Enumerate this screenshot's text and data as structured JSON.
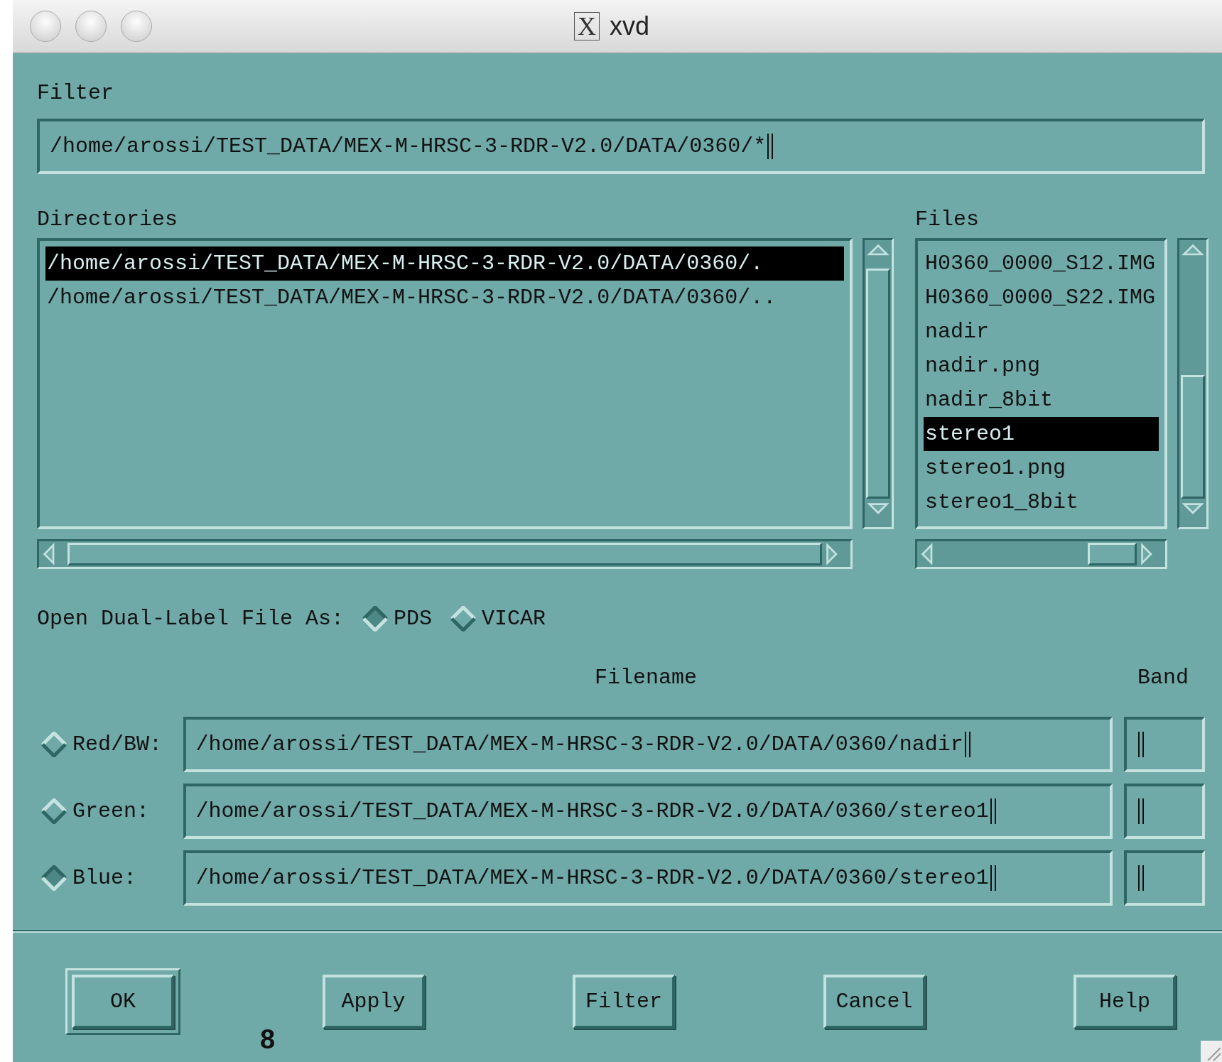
{
  "window": {
    "title": "xvd",
    "title_badge": "X"
  },
  "filter": {
    "label": "Filter",
    "value": "/home/arossi/TEST_DATA/MEX-M-HRSC-3-RDR-V2.0/DATA/0360/*"
  },
  "directories": {
    "label": "Directories",
    "items": [
      {
        "text": "/home/arossi/TEST_DATA/MEX-M-HRSC-3-RDR-V2.0/DATA/0360/.",
        "selected": true
      },
      {
        "text": "/home/arossi/TEST_DATA/MEX-M-HRSC-3-RDR-V2.0/DATA/0360/..",
        "selected": false
      }
    ]
  },
  "files": {
    "label": "Files",
    "items": [
      {
        "text": "H0360_0000_S12.IMG",
        "selected": false
      },
      {
        "text": "H0360_0000_S22.IMG",
        "selected": false
      },
      {
        "text": "nadir",
        "selected": false
      },
      {
        "text": "nadir.png",
        "selected": false
      },
      {
        "text": "nadir_8bit",
        "selected": false
      },
      {
        "text": "stereo1",
        "selected": true
      },
      {
        "text": "stereo1.png",
        "selected": false
      },
      {
        "text": "stereo1_8bit",
        "selected": false
      }
    ]
  },
  "dual_label": {
    "label": "Open Dual-Label File As:",
    "options": [
      {
        "label": "PDS",
        "selected": true
      },
      {
        "label": "VICAR",
        "selected": false
      }
    ]
  },
  "channels": {
    "filename_header": "Filename",
    "band_header": "Band",
    "rows": [
      {
        "label": "Red/BW:",
        "selected": false,
        "filename": "/home/arossi/TEST_DATA/MEX-M-HRSC-3-RDR-V2.0/DATA/0360/nadir"
      },
      {
        "label": "Green:",
        "selected": false,
        "filename": "/home/arossi/TEST_DATA/MEX-M-HRSC-3-RDR-V2.0/DATA/0360/stereo1"
      },
      {
        "label": "Blue:",
        "selected": true,
        "filename": "/home/arossi/TEST_DATA/MEX-M-HRSC-3-RDR-V2.0/DATA/0360/stereo1"
      }
    ]
  },
  "buttons": [
    {
      "label": "OK",
      "default": true
    },
    {
      "label": "Apply",
      "default": false
    },
    {
      "label": "Filter",
      "default": false
    },
    {
      "label": "Cancel",
      "default": false
    },
    {
      "label": "Help",
      "default": false
    }
  ],
  "page_number": "8"
}
